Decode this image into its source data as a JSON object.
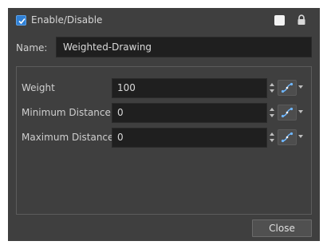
{
  "header": {
    "enable_label": "Enable/Disable",
    "enabled": true,
    "swatch_color": "#f2f2f2",
    "lock_icon": "lock-icon"
  },
  "name": {
    "label": "Name:",
    "value": "Weighted-Drawing"
  },
  "params": [
    {
      "label": "Weight",
      "value": "100"
    },
    {
      "label": "Minimum Distance",
      "value": "0"
    },
    {
      "label": "Maximum Distance",
      "value": "0"
    }
  ],
  "footer": {
    "close_label": "Close"
  },
  "colors": {
    "dialog_bg": "#3f3f3f",
    "field_bg": "#1f1f1f",
    "accent": "#2f7fd4"
  }
}
